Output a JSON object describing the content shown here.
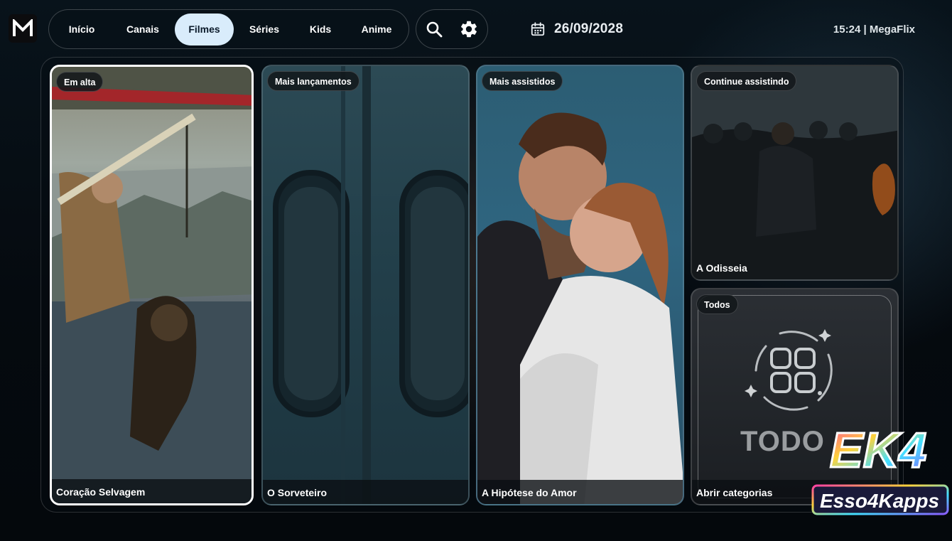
{
  "app": {
    "name": "MegaFlix",
    "logo_letter": "M"
  },
  "nav": {
    "items": [
      {
        "label": "Início",
        "active": false
      },
      {
        "label": "Canais",
        "active": false
      },
      {
        "label": "Filmes",
        "active": true
      },
      {
        "label": "Séries",
        "active": false
      },
      {
        "label": "Kids",
        "active": false
      },
      {
        "label": "Anime",
        "active": false
      }
    ]
  },
  "toolbar": {
    "search_icon": "search-icon",
    "settings_icon": "gear-icon"
  },
  "header": {
    "date": "26/09/2028",
    "clock": "15:24 | MegaFlix"
  },
  "cards": [
    {
      "badge": "Em alta",
      "title": "Coração Selvagem",
      "focused": true
    },
    {
      "badge": "Mais lançamentos",
      "title": "O Sorveteiro",
      "focused": false
    },
    {
      "badge": "Mais assistidos",
      "title": "A Hipótese do Amor",
      "focused": false
    },
    {
      "badge": "Continue assistindo",
      "title": "A Odisseia",
      "focused": false
    },
    {
      "badge": "Todos",
      "title": "Abrir categorias",
      "focused": false,
      "art_text": "TODO"
    }
  ],
  "watermark": {
    "line1": "EK4",
    "line2": "Esso4Kapps"
  },
  "colors": {
    "nav_active_bg": "#d9ecfb",
    "focus_border": "#ffffff"
  }
}
